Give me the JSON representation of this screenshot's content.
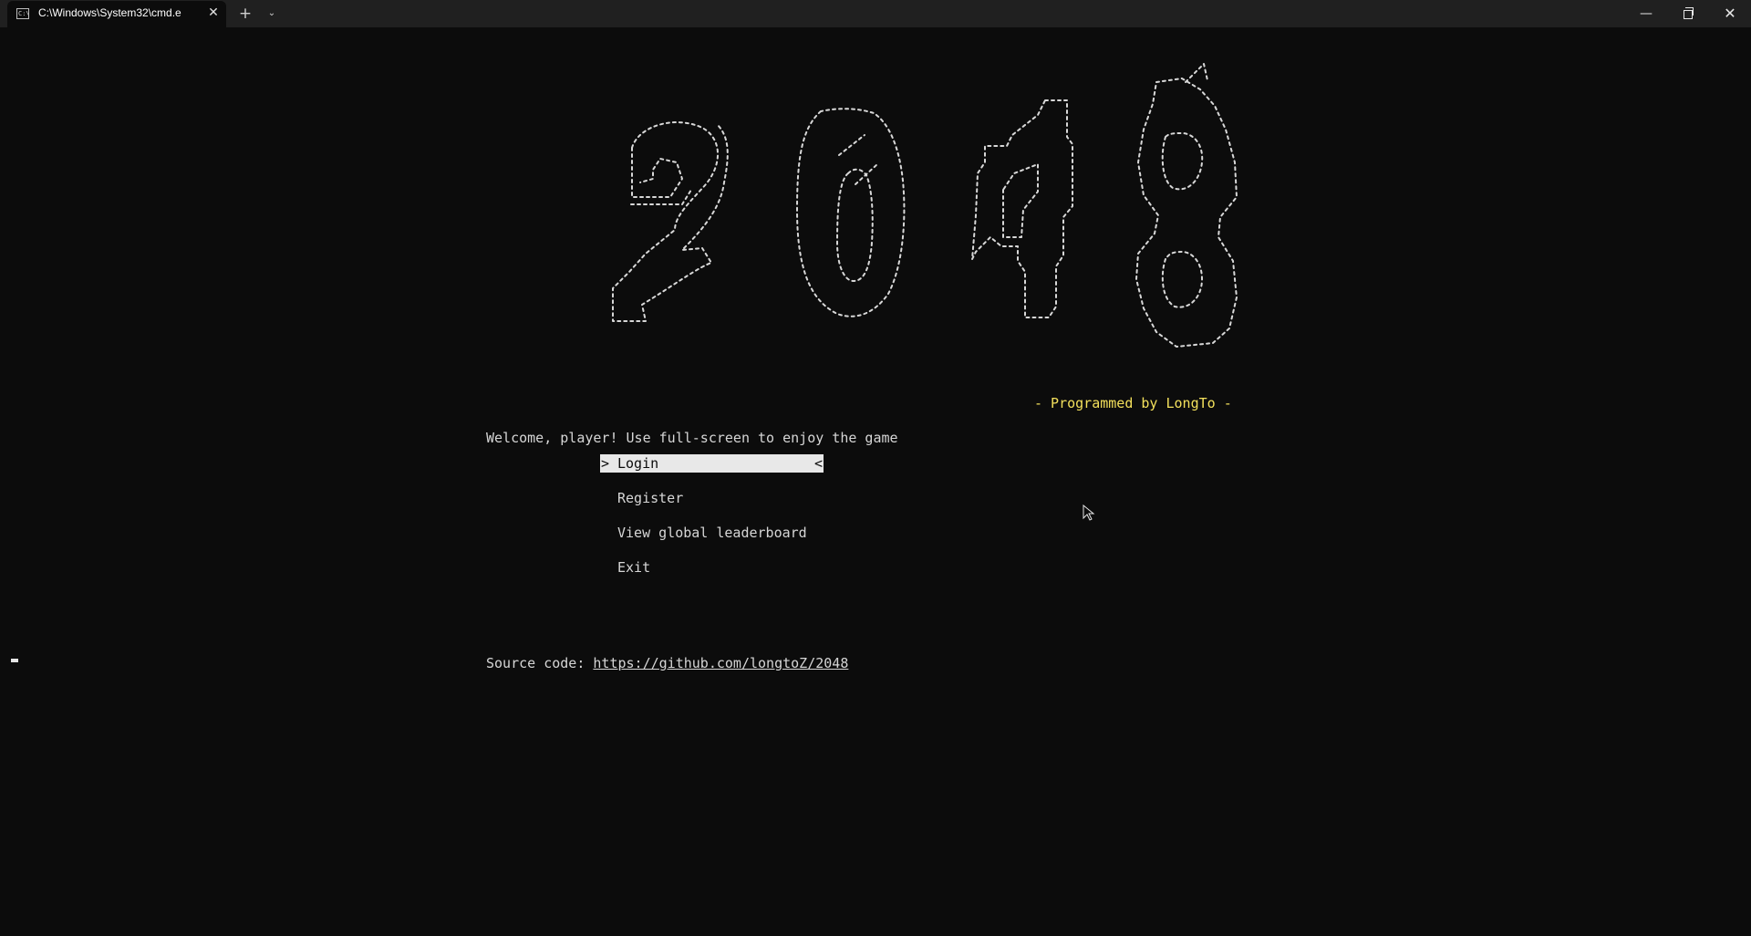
{
  "window": {
    "tab_title": "C:\\Windows\\System32\\cmd.e",
    "tab_icon_text": "C:\\",
    "close_tab_glyph": "✕",
    "new_tab_glyph": "+",
    "dropdown_glyph": "⌄",
    "minimize_glyph": "—",
    "close_glyph": "✕"
  },
  "console": {
    "logo_text": "2048",
    "credit": "- Programmed by LongTo -",
    "welcome": "Welcome, player! Use full-screen to enjoy the game",
    "menu": [
      {
        "label": "Login",
        "selected": true,
        "prefix": ">",
        "suffix": "<"
      },
      {
        "label": "Register",
        "selected": false
      },
      {
        "label": "View global leaderboard",
        "selected": false
      },
      {
        "label": "Exit",
        "selected": false
      }
    ],
    "source_label": "Source code: ",
    "source_url": "https://github.com/longtoZ/2048"
  },
  "colors": {
    "background": "#0c0c0c",
    "text": "#d6d6d6",
    "credit": "#f3e05c",
    "selection_bg": "#e8e8e8"
  },
  "icons": [
    "terminal-icon",
    "close-icon",
    "plus-icon",
    "chevron-down-icon",
    "minimize-icon",
    "restore-icon",
    "mouse-cursor-icon"
  ]
}
